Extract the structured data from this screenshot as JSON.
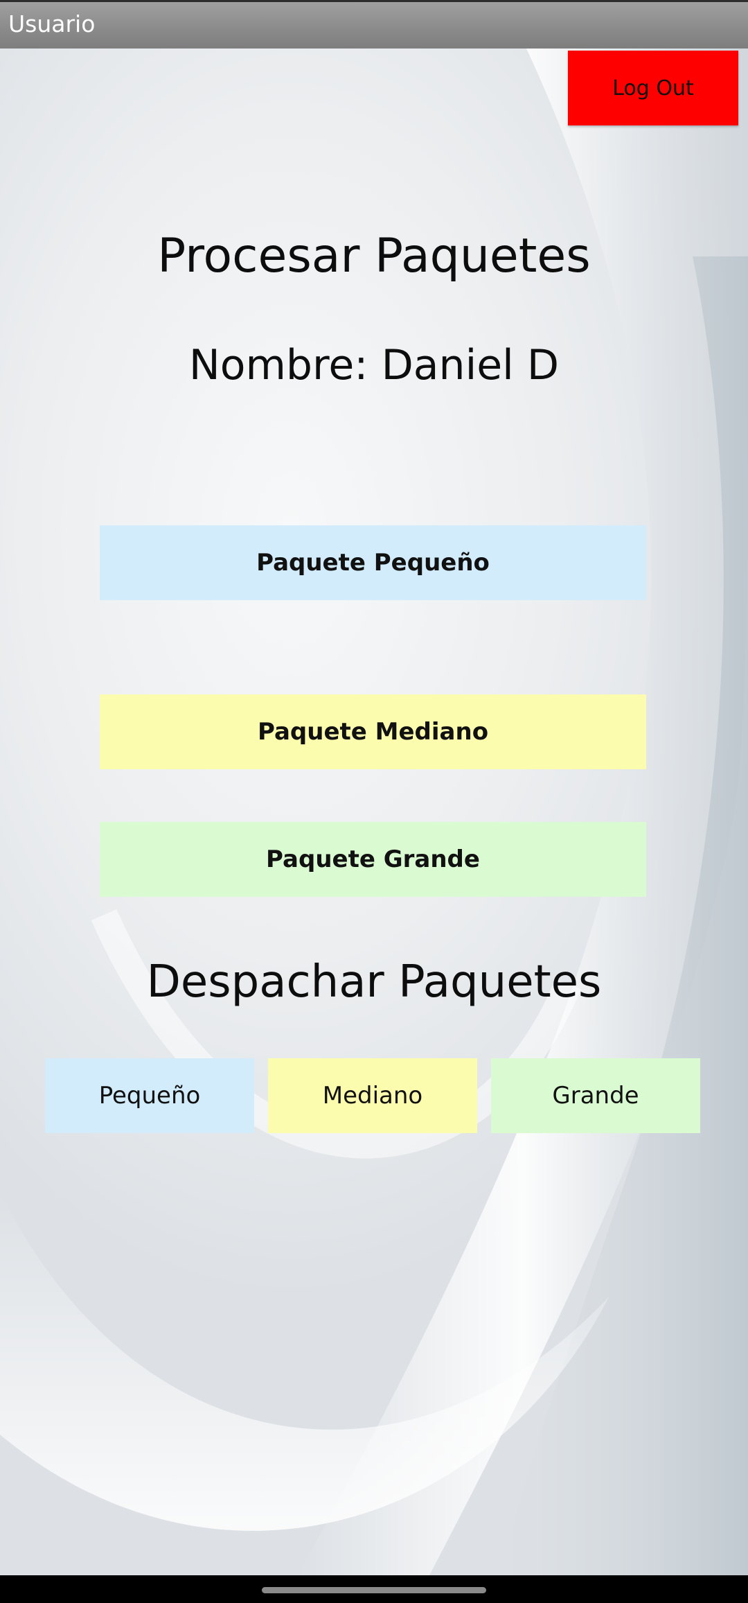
{
  "app_bar": {
    "title": "Usuario"
  },
  "logout": {
    "label": "Log Out",
    "color": "#ff0000"
  },
  "process": {
    "title": "Procesar Paquetes",
    "name_line": "Nombre: Daniel D",
    "buttons": [
      {
        "label": "Paquete Pequeño",
        "color": "#d2ecfb"
      },
      {
        "label": "Paquete Mediano",
        "color": "#fbfcae"
      },
      {
        "label": "Paquete Grande",
        "color": "#dafbd2"
      }
    ]
  },
  "dispatch": {
    "title": "Despachar Paquetes",
    "buttons": [
      {
        "label": "Pequeño",
        "color": "#d2ecfb"
      },
      {
        "label": "Mediano",
        "color": "#fbfcae"
      },
      {
        "label": "Grande",
        "color": "#dafbd2"
      }
    ]
  }
}
